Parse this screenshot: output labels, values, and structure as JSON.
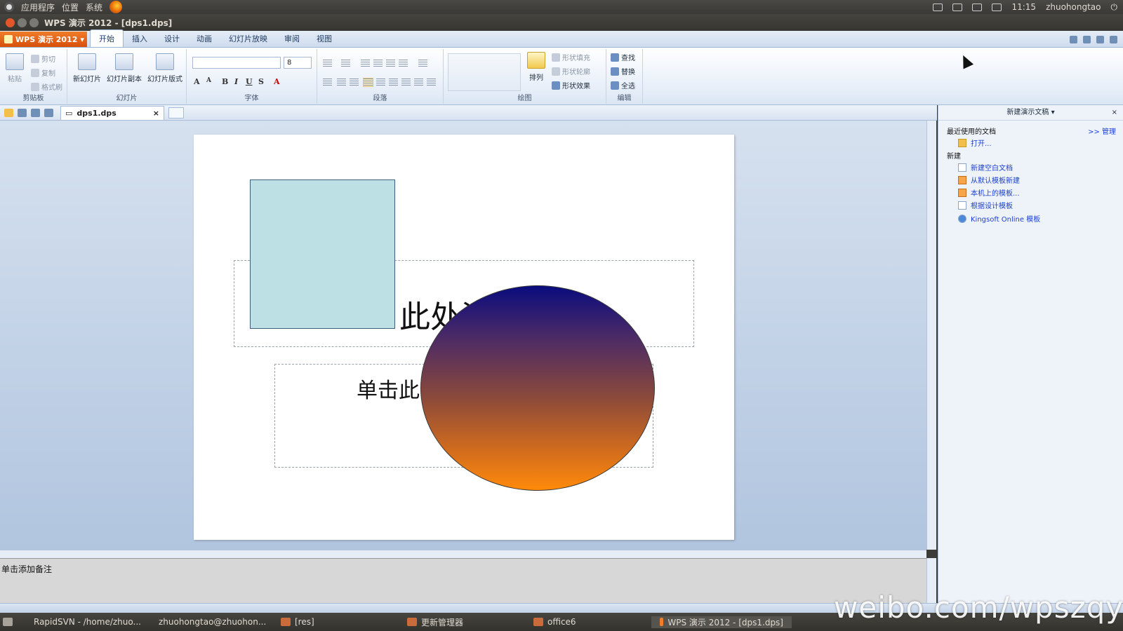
{
  "top_panel": {
    "menus": [
      "应用程序",
      "位置",
      "系统"
    ],
    "time": "11:15",
    "user": "zhuohongtao"
  },
  "window": {
    "title": "WPS 演示 2012 - [dps1.dps]"
  },
  "app_menu": {
    "label": "WPS 演示 2012"
  },
  "tabs": [
    "开始",
    "插入",
    "设计",
    "动画",
    "幻灯片放映",
    "审阅",
    "视图"
  ],
  "ribbon": {
    "clipboard": {
      "paste": "粘贴",
      "cut": "剪切",
      "copy": "复制",
      "format_painter": "格式刷",
      "label": "剪贴板"
    },
    "slides": {
      "new_slide": "新幻灯片",
      "duplicate": "幻灯片副本",
      "layout": "幻灯片版式",
      "label": "幻灯片"
    },
    "font": {
      "font_name": "",
      "font_size": "8",
      "label": "字体"
    },
    "paragraph": {
      "label": "段落"
    },
    "drawing": {
      "arrange": "排列",
      "shape_fill": "形状填充",
      "shape_outline": "形状轮廓",
      "shape_effects": "形状效果",
      "label": "绘图"
    },
    "editing": {
      "find": "查找",
      "replace": "替换",
      "select_all": "全选",
      "label": "编辑"
    }
  },
  "document_tab": {
    "name": "dps1.dps"
  },
  "slide": {
    "title_placeholder": "此处添",
    "subtitle_placeholder": "单击此",
    "colors": {
      "rect_fill": "#bce0e3",
      "ellipse_top": "#0a0c7e",
      "ellipse_bottom": "#ff8a0a"
    }
  },
  "notes": {
    "placeholder": "单击添加备注"
  },
  "task_pane": {
    "title": "新建演示文稿",
    "recent_label": "最近使用的文档",
    "manage_link": ">> 管理",
    "open_link": "打开...",
    "new_label": "新建",
    "links": [
      "新建空白文档",
      "从默认模板新建",
      "本机上的模板...",
      "根据设计模板",
      "Kingsoft Online 模板"
    ]
  },
  "taskbar": {
    "items": [
      "RapidSVN - /home/zhuo...",
      "zhuohongtao@zhuohon...",
      "[res]",
      "更新管理器",
      "office6",
      "WPS 演示 2012 - [dps1.dps]"
    ]
  },
  "watermark": "weibo.com/wpszqy"
}
